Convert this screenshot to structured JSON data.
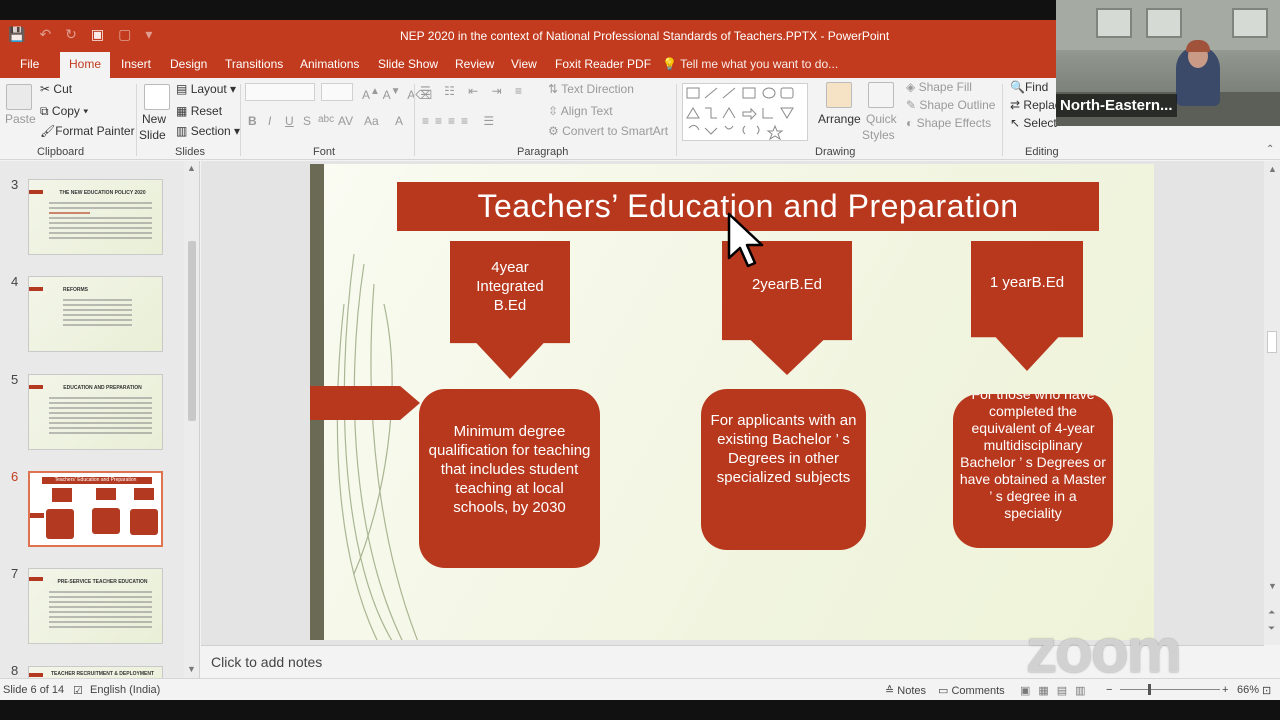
{
  "window": {
    "title": "NEP 2020   in the context of National Professional Standards of Teachers.PPTX  -  PowerPoint"
  },
  "tabs": [
    "File",
    "Home",
    "Insert",
    "Design",
    "Transitions",
    "Animations",
    "Slide Show",
    "Review",
    "View",
    "Foxit Reader PDF"
  ],
  "tell_me": "Tell me what you want to do...",
  "ribbon": {
    "clipboard": {
      "paste": "Paste",
      "cut": "Cut",
      "copy": "Copy",
      "format_painter": "Format Painter",
      "group": "Clipboard"
    },
    "slides": {
      "new_slide_1": "New",
      "new_slide_2": "Slide",
      "layout": "Layout",
      "reset": "Reset",
      "section": "Section",
      "group": "Slides"
    },
    "font": {
      "group": "Font",
      "bold": "B",
      "italic": "I",
      "underline": "U",
      "strike": "S",
      "shadow": "abc",
      "spacing": "AV",
      "case": "Aa",
      "color": "A"
    },
    "paragraph": {
      "group": "Paragraph",
      "text_direction": "Text Direction",
      "align_text": "Align Text",
      "smartart": "Convert to SmartArt"
    },
    "drawing": {
      "group": "Drawing",
      "arrange": "Arrange",
      "quick_styles_1": "Quick",
      "quick_styles_2": "Styles",
      "shape_fill": "Shape Fill",
      "shape_outline": "Shape Outline",
      "shape_effects": "Shape Effects"
    },
    "editing": {
      "group": "Editing",
      "find": "Find",
      "replace": "Replac",
      "select": "Select"
    }
  },
  "thumbnails": [
    {
      "num": "3",
      "title": "THE NEW EDUCATION POLICY 2020"
    },
    {
      "num": "4",
      "title": "REFORMS"
    },
    {
      "num": "5",
      "title": "EDUCATION AND PREPARATION"
    },
    {
      "num": "6",
      "title": "Teachers' Education and Preparation"
    },
    {
      "num": "7",
      "title": "PRE-SERVICE TEACHER EDUCATION"
    },
    {
      "num": "8",
      "title": "TEACHER RECRUITMENT & DEPLOYMENT"
    }
  ],
  "slide": {
    "title": "Teachers’ Education and Preparation",
    "arrow_labels": [
      "4year Integrated B.Ed",
      "2yearB.Ed",
      "1 yearB.Ed"
    ],
    "box_texts": [
      "Minimum degree qualification for teaching that includes student teaching at local schools, by 2030",
      "For applicants with an existing Bachelor ’ s Degrees in other specialized subjects",
      "For those who have completed the equivalent of 4-year multidisciplinary Bachelor ’ s Degrees or have obtained a Master ’ s degree in a speciality"
    ]
  },
  "notes_placeholder": "Click to add notes",
  "status": {
    "slide": "Slide 6 of 14",
    "language": "English (India)",
    "notes": "Notes",
    "comments": "Comments",
    "zoom": "66%"
  },
  "video": {
    "name": "North-Eastern..."
  },
  "watermark": "zoom"
}
